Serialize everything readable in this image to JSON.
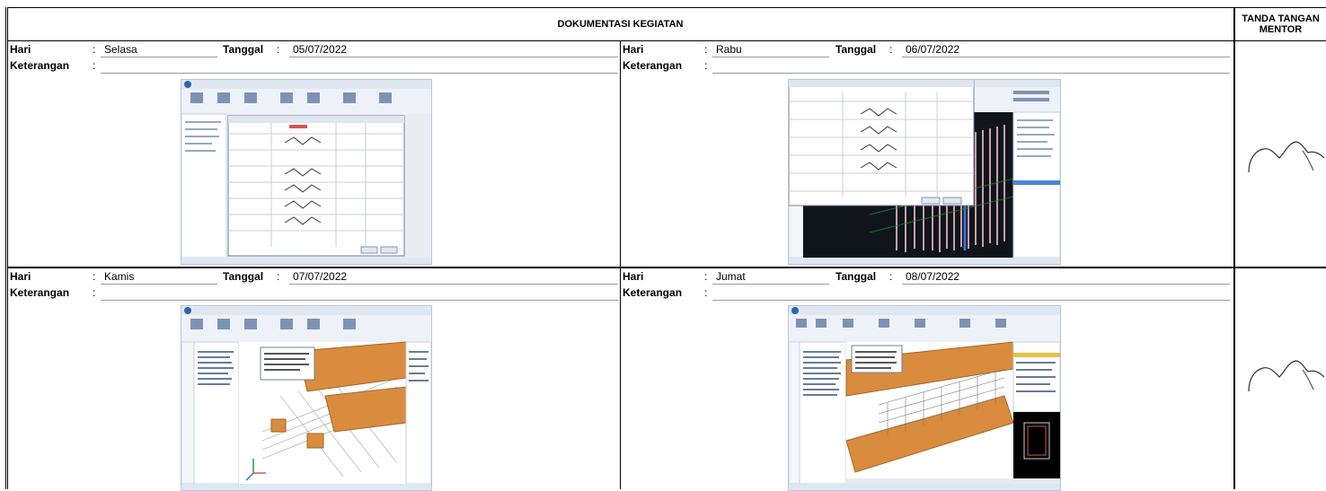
{
  "header": {
    "title": "DOKUMENTASI KEGIATAN",
    "signature_col": "TANDA TANGAN MENTOR"
  },
  "labels": {
    "day": "Hari",
    "date": "Tanggal",
    "note": "Keterangan",
    "colon": ":"
  },
  "entries": [
    {
      "day": "Selasa",
      "date": "05/07/2022",
      "keterangan": "",
      "screenshot": "software window with rebar shape table dialog"
    },
    {
      "day": "Rabu",
      "date": "06/07/2022",
      "keterangan": "",
      "screenshot": "software window with table dialog over pink 3D column model"
    },
    {
      "day": "Kamis",
      "date": "07/07/2022",
      "keterangan": "",
      "screenshot": "software window with orange 3D foundation model and rebar mesh"
    },
    {
      "day": "Jumat",
      "date": "08/07/2022",
      "keterangan": "",
      "screenshot": "software window with orange 3D beams and rebar cage"
    }
  ],
  "colors": {
    "border": "#000000",
    "ribbon": "#dde6f3",
    "orange_model": "#d98c3e",
    "pink_model": "#c9a0a8",
    "dark_viewport": "#10151c"
  }
}
